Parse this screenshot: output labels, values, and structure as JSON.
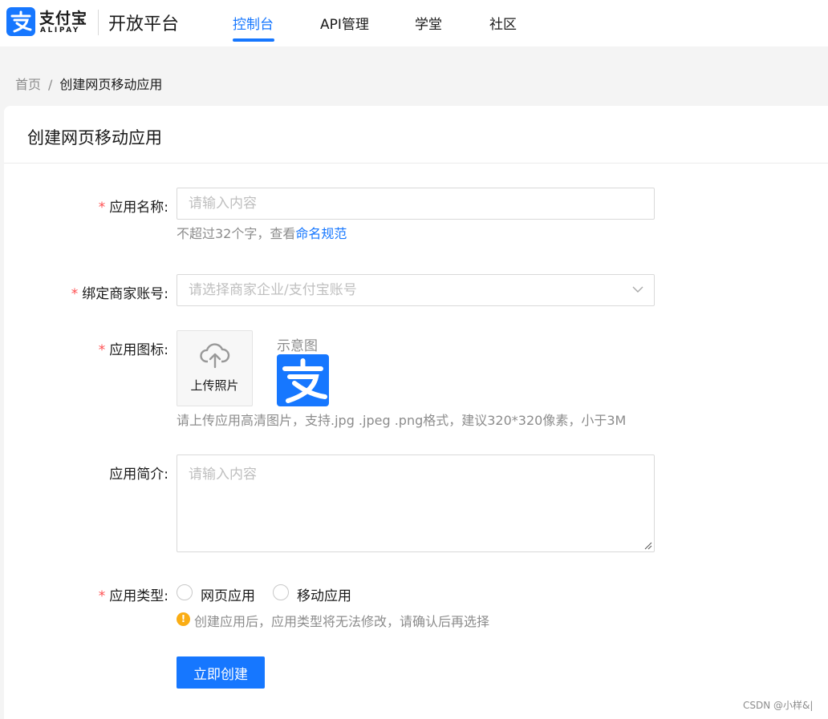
{
  "header": {
    "logo_cn": "支付宝",
    "logo_en": "ALIPAY",
    "platform": "开放平台",
    "nav": [
      {
        "label": "控制台",
        "active": true
      },
      {
        "label": "API管理",
        "active": false
      },
      {
        "label": "学堂",
        "active": false
      },
      {
        "label": "社区",
        "active": false
      }
    ]
  },
  "breadcrumb": {
    "home": "首页",
    "separator": "/",
    "current": "创建网页移动应用"
  },
  "card": {
    "title": "创建网页移动应用"
  },
  "form": {
    "required_mark": "*",
    "app_name": {
      "label": "应用名称:",
      "placeholder": "请输入内容",
      "help_prefix": "不超过32个字，查看",
      "help_link": "命名规范"
    },
    "merchant_account": {
      "label": "绑定商家账号:",
      "placeholder": "请选择商家企业/支付宝账号"
    },
    "app_icon": {
      "label": "应用图标:",
      "upload_text": "上传照片",
      "demo_label": "示意图",
      "help": "请上传应用高清图片，支持.jpg .jpeg .png格式，建议320*320像素，小于3M"
    },
    "app_intro": {
      "label": "应用简介:",
      "placeholder": "请输入内容"
    },
    "app_type": {
      "label": "应用类型:",
      "options": [
        {
          "label": "网页应用",
          "selected": false
        },
        {
          "label": "移动应用",
          "selected": false
        }
      ],
      "warning_icon": "!",
      "warning": "创建应用后，应用类型将无法修改，请确认后再选择"
    },
    "submit_label": "立即创建"
  },
  "watermark": "CSDN @小样&|",
  "colors": {
    "accent": "#1677ff",
    "required": "#ff4d4f",
    "warning": "#faad14"
  }
}
